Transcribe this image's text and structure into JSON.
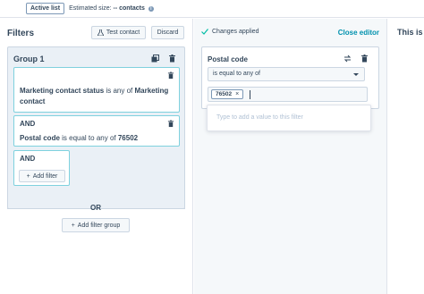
{
  "topbar": {
    "active_list": "Active list",
    "estimated_label": "Estimated size:",
    "estimated_value": "-- contacts",
    "info_icon": "info-icon"
  },
  "filters": {
    "title": "Filters",
    "test_contact": "Test contact",
    "discard": "Discard",
    "group": {
      "title": "Group 1",
      "filter1": {
        "property": "Marketing contact status",
        "operator": " is any of ",
        "value": "Marketing contact"
      },
      "and1": "AND",
      "filter2": {
        "property": "Postal code",
        "operator": " is equal to any of ",
        "value": "76502"
      },
      "and2": "AND",
      "add_filter": "Add filter"
    },
    "or": "OR",
    "add_filter_group": "Add filter group"
  },
  "editor": {
    "status": "Changes applied",
    "close": "Close editor",
    "property_title": "Postal code",
    "operator_selected": "is equal to any of",
    "tags": [
      "76502"
    ],
    "input_placeholder": "Type to add a value to this filter"
  },
  "right_panel": {
    "title": "This is"
  },
  "colors": {
    "accent": "#0091ae",
    "text": "#33475b",
    "border_highlight": "#7fd1de",
    "success": "#00bda5"
  }
}
